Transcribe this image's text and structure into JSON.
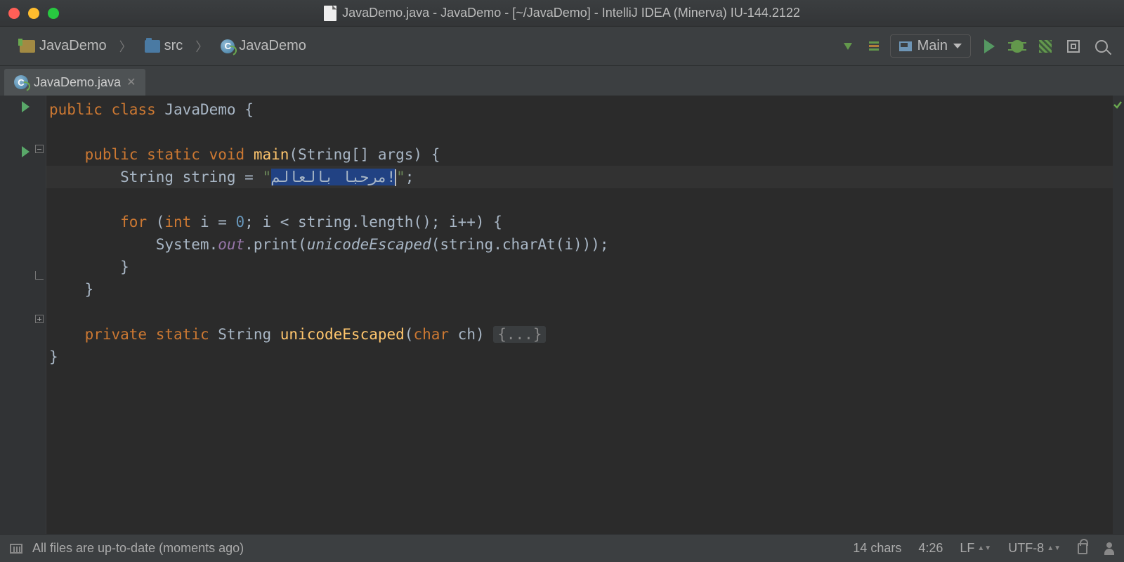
{
  "window": {
    "title": "JavaDemo.java - JavaDemo - [~/JavaDemo] - IntelliJ IDEA (Minerva) IU-144.2122"
  },
  "breadcrumb": {
    "items": [
      {
        "label": "JavaDemo",
        "icon": "project"
      },
      {
        "label": "src",
        "icon": "folder"
      },
      {
        "label": "JavaDemo",
        "icon": "class"
      }
    ]
  },
  "run_config": {
    "label": "Main"
  },
  "tabs": [
    {
      "label": "JavaDemo.java",
      "active": true
    }
  ],
  "code": {
    "l1": {
      "kw1": "public",
      "kw2": "class",
      "name": "JavaDemo",
      "brace": " {"
    },
    "l2": {
      "kw1": "public",
      "kw2": "static",
      "kw3": "void",
      "name": "main",
      "params": "(String[] args) {"
    },
    "l3": {
      "typ": "String",
      "var": " string = ",
      "q1": "\"",
      "sel": "!مرحبا بالعالم",
      "q2": "\"",
      "semi": ";"
    },
    "l4": {
      "kw": "for",
      "open": " (",
      "kwint": "int",
      "rest": " i = ",
      "zero": "0",
      "rest2": "; i < string.length(); i++) {"
    },
    "l5": {
      "sys": "System.",
      "out": "out",
      "print": ".print(",
      "fn": "unicodeEscaped",
      "rest": "(string.charAt(i)));"
    },
    "l6brace": "}",
    "l7brace": "}",
    "l8": {
      "kw1": "private",
      "kw2": "static",
      "typ": "String",
      "name": "unicodeEscaped",
      "open": "(",
      "kwchar": "char",
      "rest": " ch) ",
      "fold": "{...}"
    },
    "l9brace": "}"
  },
  "status": {
    "left": "All files are up-to-date (moments ago)",
    "chars": "14 chars",
    "pos": "4:26",
    "le": "LF",
    "enc": "UTF-8"
  }
}
